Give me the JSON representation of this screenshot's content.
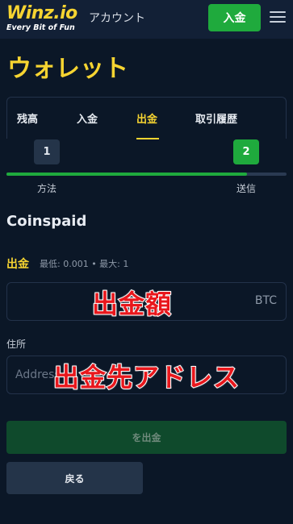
{
  "header": {
    "logo_text": "Winz.io",
    "logo_tagline": "Every Bit of Fun",
    "account_label": "アカウント",
    "deposit_label": "入金",
    "menu_icon": "hamburger-menu-icon"
  },
  "page": {
    "title": "ウォレット"
  },
  "tabs": [
    {
      "label": "残高",
      "active": false
    },
    {
      "label": "入金",
      "active": false
    },
    {
      "label": "出金",
      "active": true
    },
    {
      "label": "取引履歴",
      "active": false
    }
  ],
  "stepper": {
    "steps": [
      {
        "number": "1",
        "label": "方法",
        "complete": false
      },
      {
        "number": "2",
        "label": "送信",
        "complete": true
      }
    ],
    "progress": 0.86,
    "colors": {
      "active": "#1faa3d",
      "inactive": "#243449"
    }
  },
  "withdraw_form": {
    "method_name": "Coinspaid",
    "amount_label": "出金",
    "amount_limits": "最低: 0.001 • 最大: 1",
    "amount_currency": "BTC",
    "amount_value": "",
    "address_label": "住所",
    "address_placeholder": "Address",
    "address_value": "",
    "submit_label": "を出金",
    "back_label": "戻る"
  },
  "annotations": {
    "amount_caption": "出金額",
    "address_caption": "出金先アドレス",
    "color": "#e8171c"
  },
  "theme": {
    "accent": "#f6d431",
    "brand_green": "#1faa3d",
    "background": "#0b1727"
  }
}
